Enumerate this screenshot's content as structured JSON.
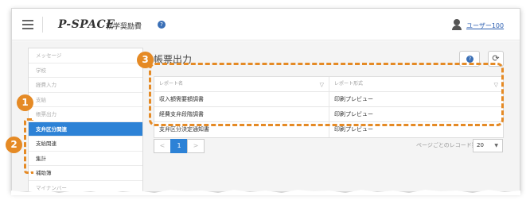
{
  "header": {
    "logo": "P-SPACE",
    "app_name": "就学奨励費",
    "user_name": "ユーザー100"
  },
  "sidebar": {
    "items": [
      {
        "label": "メッセージ",
        "state": "inactive"
      },
      {
        "label": "学校",
        "state": "inactive"
      },
      {
        "label": "経費入力",
        "state": "inactive"
      },
      {
        "label": "支給",
        "state": "inactive"
      },
      {
        "label": "帳票出力",
        "state": "inactive"
      },
      {
        "label": "支弁区分関連",
        "state": "active"
      },
      {
        "label": "支給関連",
        "state": "normal"
      },
      {
        "label": "集計",
        "state": "normal"
      },
      {
        "label": "補助簿",
        "state": "normal"
      },
      {
        "label": "マイナンバー",
        "state": "inactive"
      }
    ]
  },
  "main": {
    "title": "帳票出力",
    "table": {
      "columns": [
        "レポート名",
        "レポート形式"
      ],
      "rows": [
        [
          "収入額需要額調書",
          "印刷プレビュー"
        ],
        [
          "経費支弁段階調書",
          "印刷プレビュー"
        ],
        [
          "支弁区分決定通知書",
          "印刷プレビュー"
        ]
      ]
    },
    "pager": {
      "prev": "<",
      "current": "1",
      "next": ">",
      "per_page_label": "ページごとのレコード数",
      "per_page_value": "20"
    }
  },
  "annotations": [
    "1",
    "2",
    "3"
  ],
  "colors": {
    "accent": "#2d82d6",
    "annotation": "#e58a25"
  }
}
